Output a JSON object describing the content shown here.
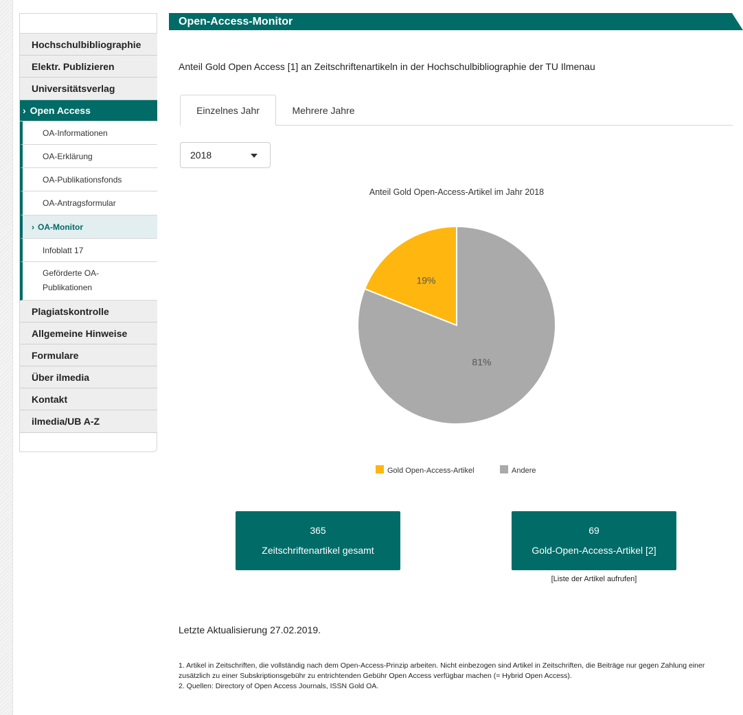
{
  "sidebar": {
    "items": [
      {
        "label": "Hochschulbibliographie"
      },
      {
        "label": "Elektr. Publizieren"
      },
      {
        "label": "Universitätsverlag"
      },
      {
        "label": "Open Access"
      },
      {
        "label": "Plagiatskontrolle"
      },
      {
        "label": "Allgemeine Hinweise"
      },
      {
        "label": "Formulare"
      },
      {
        "label": "Über ilmedia"
      },
      {
        "label": "Kontakt"
      },
      {
        "label": "ilmedia/UB A-Z"
      }
    ],
    "subitems": [
      {
        "label": "OA-Informationen"
      },
      {
        "label": "OA-Erklärung"
      },
      {
        "label": "OA-Publikationsfonds"
      },
      {
        "label": "OA-Antragsformular"
      },
      {
        "label": "OA-Monitor"
      },
      {
        "label": "Infoblatt 17"
      },
      {
        "label": "Geförderte OA-Publikationen"
      }
    ],
    "chevron": "›"
  },
  "header": {
    "title": "Open-Access-Monitor"
  },
  "intro": "Anteil Gold Open Access [1] an Zeitschriftenartikeln in der Hochschulbibliographie der TU Ilmenau",
  "tabs": [
    {
      "label": "Einzelnes Jahr",
      "active": true
    },
    {
      "label": "Mehrere Jahre",
      "active": false
    }
  ],
  "year_select": {
    "value": "2018"
  },
  "colors": {
    "accent": "#006b67",
    "gold": "#ffb70f",
    "other": "#aaaaaa"
  },
  "chart_data": {
    "type": "pie",
    "title": "Anteil Gold Open-Access-Artikel im Jahr 2018",
    "categories": [
      "Gold Open-Access-Artikel",
      "Andere"
    ],
    "values": [
      19,
      81
    ],
    "labels": [
      "19%",
      "81%"
    ],
    "colors": [
      "#ffb70f",
      "#aaaaaa"
    ],
    "legend_position": "bottom"
  },
  "stats": [
    {
      "value": "365",
      "label": "Zeitschriftenartikel gesamt"
    },
    {
      "value": "69",
      "label": "Gold-Open-Access-Artikel [2]"
    }
  ],
  "list_link": "[Liste der Artikel aufrufen]",
  "updated": "Letzte Aktualisierung 27.02.2019.",
  "footnotes": [
    "1. Artikel in Zeitschriften, die vollständig nach dem Open-Access-Prinzip arbeiten. Nicht einbezogen sind Artikel in Zeitschriften, die Beiträge nur gegen Zahlung einer zusätzlich zu einer Subskriptionsgebühr zu entrichtenden Gebühr Open Access verfügbar machen (= Hybrid Open Access).",
    "2. Quellen: Directory of Open Access Journals, ISSN Gold OA."
  ]
}
